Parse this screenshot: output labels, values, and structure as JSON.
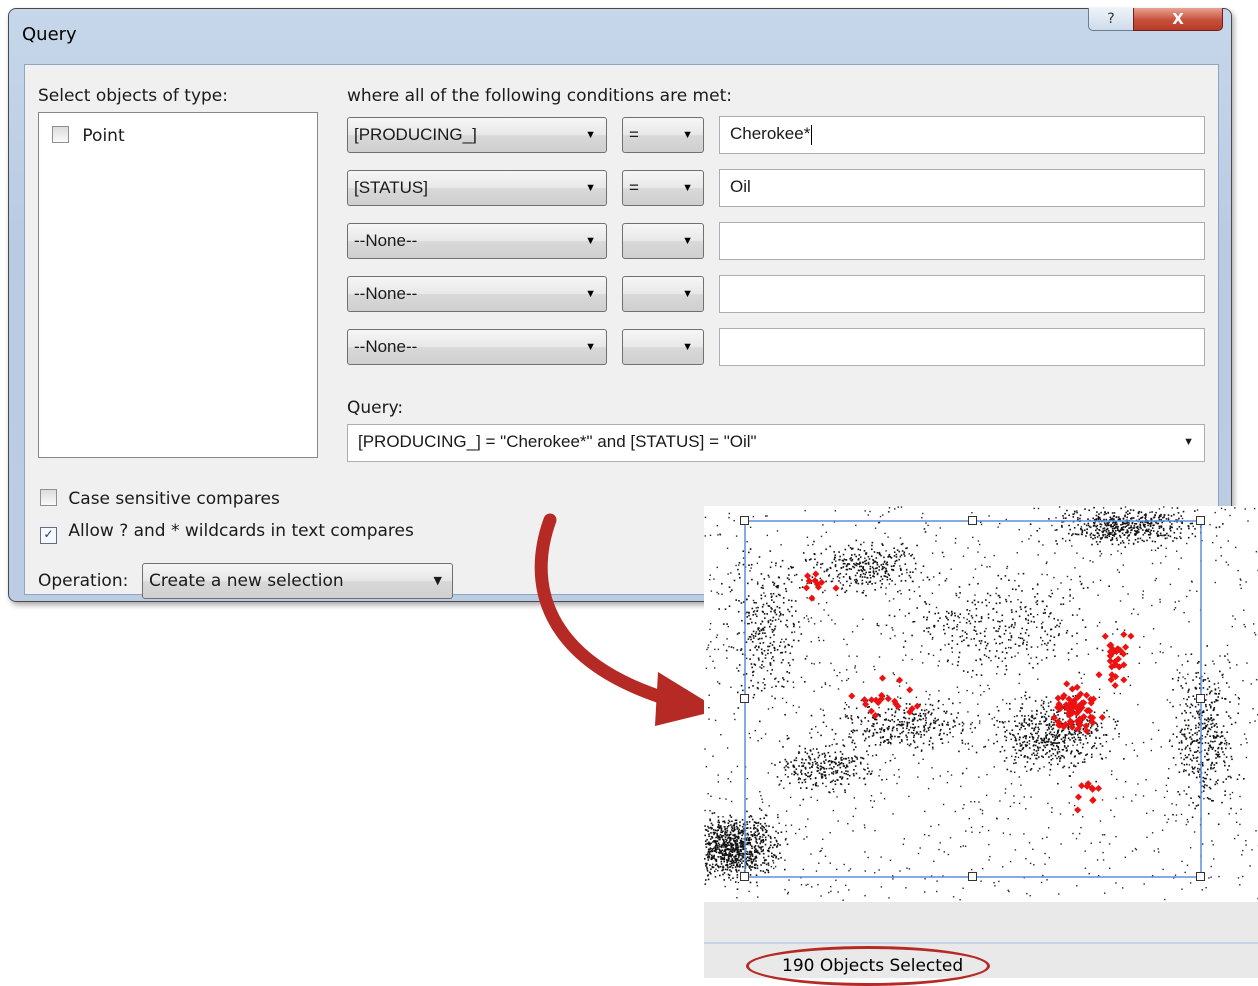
{
  "window": {
    "title": "Query",
    "help_icon": "?",
    "close_icon": "X"
  },
  "types": {
    "label": "Select objects of type:",
    "items": [
      {
        "label": "Point",
        "checked": false
      }
    ]
  },
  "conditions": {
    "label": "where all of the following conditions are met:",
    "rows": [
      {
        "field": "[PRODUCING_]",
        "op": "=",
        "value": "Cherokee*"
      },
      {
        "field": "[STATUS]",
        "op": "=",
        "value": "Oil"
      },
      {
        "field": "--None--",
        "op": "",
        "value": ""
      },
      {
        "field": "--None--",
        "op": "",
        "value": ""
      },
      {
        "field": "--None--",
        "op": "",
        "value": ""
      }
    ]
  },
  "query": {
    "label": "Query:",
    "text": "[PRODUCING_] = \"Cherokee*\" and [STATUS] = \"Oil\""
  },
  "options": {
    "case_sensitive": {
      "label": "Case sensitive compares",
      "checked": false
    },
    "wildcards": {
      "label": "Allow ? and * wildcards in text compares",
      "checked": true
    }
  },
  "operation": {
    "label": "Operation:",
    "value": "Create a new selection"
  },
  "status": {
    "text": "190 Objects Selected"
  },
  "colors": {
    "accent_red": "#b52a25",
    "selected_point": "#ee1111",
    "selection_box": "#5b8ee0"
  },
  "icons": {
    "dropdown": "chevron-down-icon",
    "help": "help-icon",
    "close": "close-icon",
    "arrow": "curved-arrow-icon"
  }
}
